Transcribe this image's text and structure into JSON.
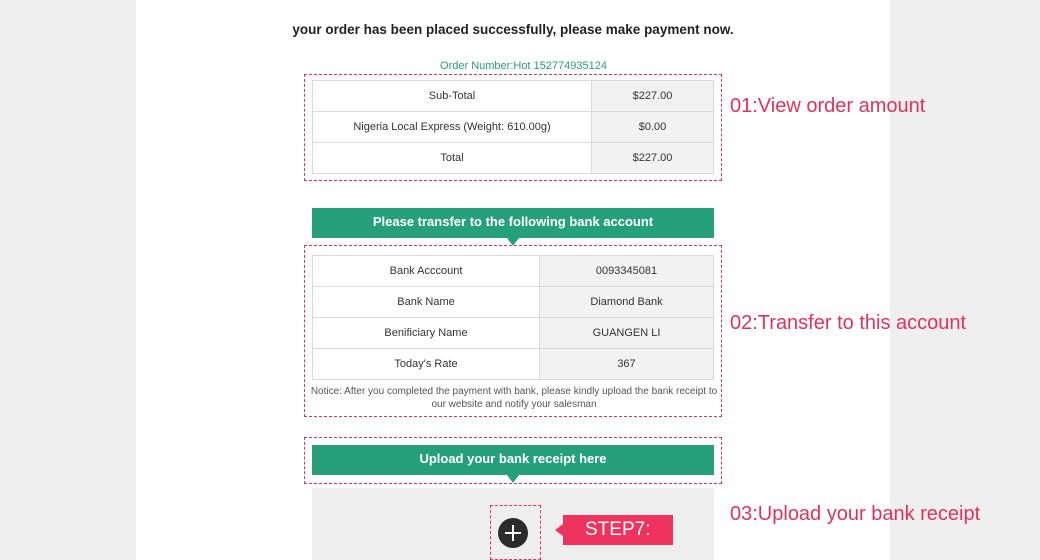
{
  "headline": "your order has been placed successfully, please make payment now.",
  "order_number": "Order Number:Hot 152774935124",
  "summary": {
    "rows": [
      {
        "label": "Sub-Total",
        "value": "$227.00"
      },
      {
        "label": "Nigeria Local Express (Weight: 610.00g)",
        "value": "$0.00"
      },
      {
        "label": "Total",
        "value": "$227.00"
      }
    ]
  },
  "bank": {
    "banner": "Please transfer to the following bank account",
    "rows": [
      {
        "label": "Bank Acccount",
        "value": "0093345081"
      },
      {
        "label": "Bank Name",
        "value": "Diamond Bank"
      },
      {
        "label": "Benificiary Name",
        "value": "GUANGEN LI"
      },
      {
        "label": "Today's Rate",
        "value": "367"
      }
    ],
    "notice": "Notice: After you completed the payment with bank, please kindly upload the bank receipt to our website and notify your salesman"
  },
  "upload": {
    "banner": "Upload your bank receipt here",
    "step_label": "STEP7:"
  },
  "callouts": {
    "c1": "01:View order amount",
    "c2": "02:Transfer to this account",
    "c3": "03:Upload your bank receipt"
  },
  "colors": {
    "accent_green": "#26a07a",
    "annotation_red": "#e0325a",
    "step_badge": "#f0325f"
  },
  "icons": {
    "upload": "plus-circle-icon"
  }
}
